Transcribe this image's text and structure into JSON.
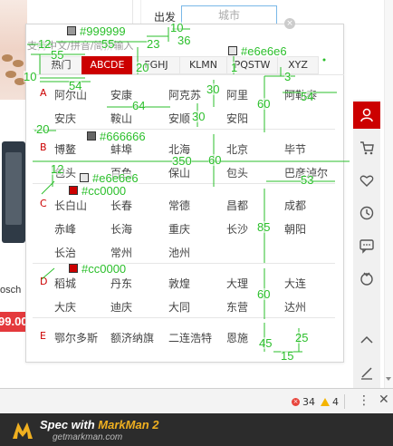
{
  "page": {
    "depart_label": "出发",
    "city_placeholder": "城市",
    "hint": "支持中文/拼音/简拼输入",
    "close_glyph": "×",
    "bg_bosch": "osch",
    "bg_price": "99.00"
  },
  "tabs": [
    {
      "label": "热门"
    },
    {
      "label": "ABCDE"
    },
    {
      "label": "FGHJ"
    },
    {
      "label": "KLMN"
    },
    {
      "label": "PQSTW"
    },
    {
      "label": "XYZ"
    }
  ],
  "active_tab": "ABCDE",
  "groups": [
    {
      "letter": "A",
      "cities": [
        "阿尔山",
        "安康",
        "阿克苏",
        "阿里",
        "阿勒泰",
        "安庆",
        "鞍山",
        "安顺",
        "安阳"
      ]
    },
    {
      "letter": "B",
      "cities": [
        "博鳌",
        "蚌埠",
        "北海",
        "北京",
        "毕节",
        "包头",
        "百色",
        "保山",
        "包头",
        "巴彦淖尔"
      ]
    },
    {
      "letter": "C",
      "cities": [
        "长白山",
        "长春",
        "常德",
        "昌都",
        "成都",
        "赤峰",
        "长海",
        "重庆",
        "长沙",
        "朝阳",
        "长治",
        "常州",
        "池州"
      ]
    },
    {
      "letter": "D",
      "cities": [
        "稻城",
        "丹东",
        "敦煌",
        "大理",
        "大连",
        "大庆",
        "迪庆",
        "大同",
        "东营",
        "达州"
      ]
    },
    {
      "letter": "E",
      "cities": [
        "鄂尔多斯",
        "额济纳旗",
        "二连浩特",
        "恩施"
      ]
    }
  ],
  "annotations": {
    "colors": [
      {
        "text": "#999999",
        "swatch": "#999999"
      },
      {
        "text": "#e6e6e6",
        "swatch": "#e6e6e6"
      },
      {
        "text": "#666666",
        "swatch": "#666666"
      },
      {
        "text": "#e6e6e6",
        "swatch": "#e6e6e6"
      },
      {
        "text": "#cc0000",
        "swatch": "#cc0000"
      },
      {
        "text": "#cc0000",
        "swatch": "#cc0000"
      }
    ],
    "measures": [
      "12",
      "55",
      "23",
      "10",
      "36",
      "55",
      "10",
      "20",
      "1",
      "3",
      "54",
      "30",
      "64",
      "54",
      "60",
      "30",
      "20",
      "350",
      "60",
      "12",
      "53",
      "85",
      "60",
      "45",
      "25",
      "15"
    ]
  },
  "right_toolbar": [
    {
      "icon": "user-icon"
    },
    {
      "icon": "cart-icon"
    },
    {
      "icon": "heart-icon"
    },
    {
      "icon": "history-icon"
    },
    {
      "icon": "chat-icon"
    },
    {
      "icon": "coupon-icon"
    },
    {
      "icon": "back-to-top-icon"
    },
    {
      "icon": "edit-icon"
    }
  ],
  "status_bar": {
    "errors": "34",
    "warnings": "4",
    "menu_glyph": "⋮",
    "close_glyph": "✕"
  },
  "footer": {
    "title_prefix": "Spec with ",
    "title_brand": "MarkMan 2",
    "url": "getmarkman.com"
  },
  "colors": {
    "accent": "#cc0000",
    "annotation": "#2bbf2b",
    "border": "#e6e6e6",
    "hint_text": "#999999",
    "text": "#666666"
  }
}
